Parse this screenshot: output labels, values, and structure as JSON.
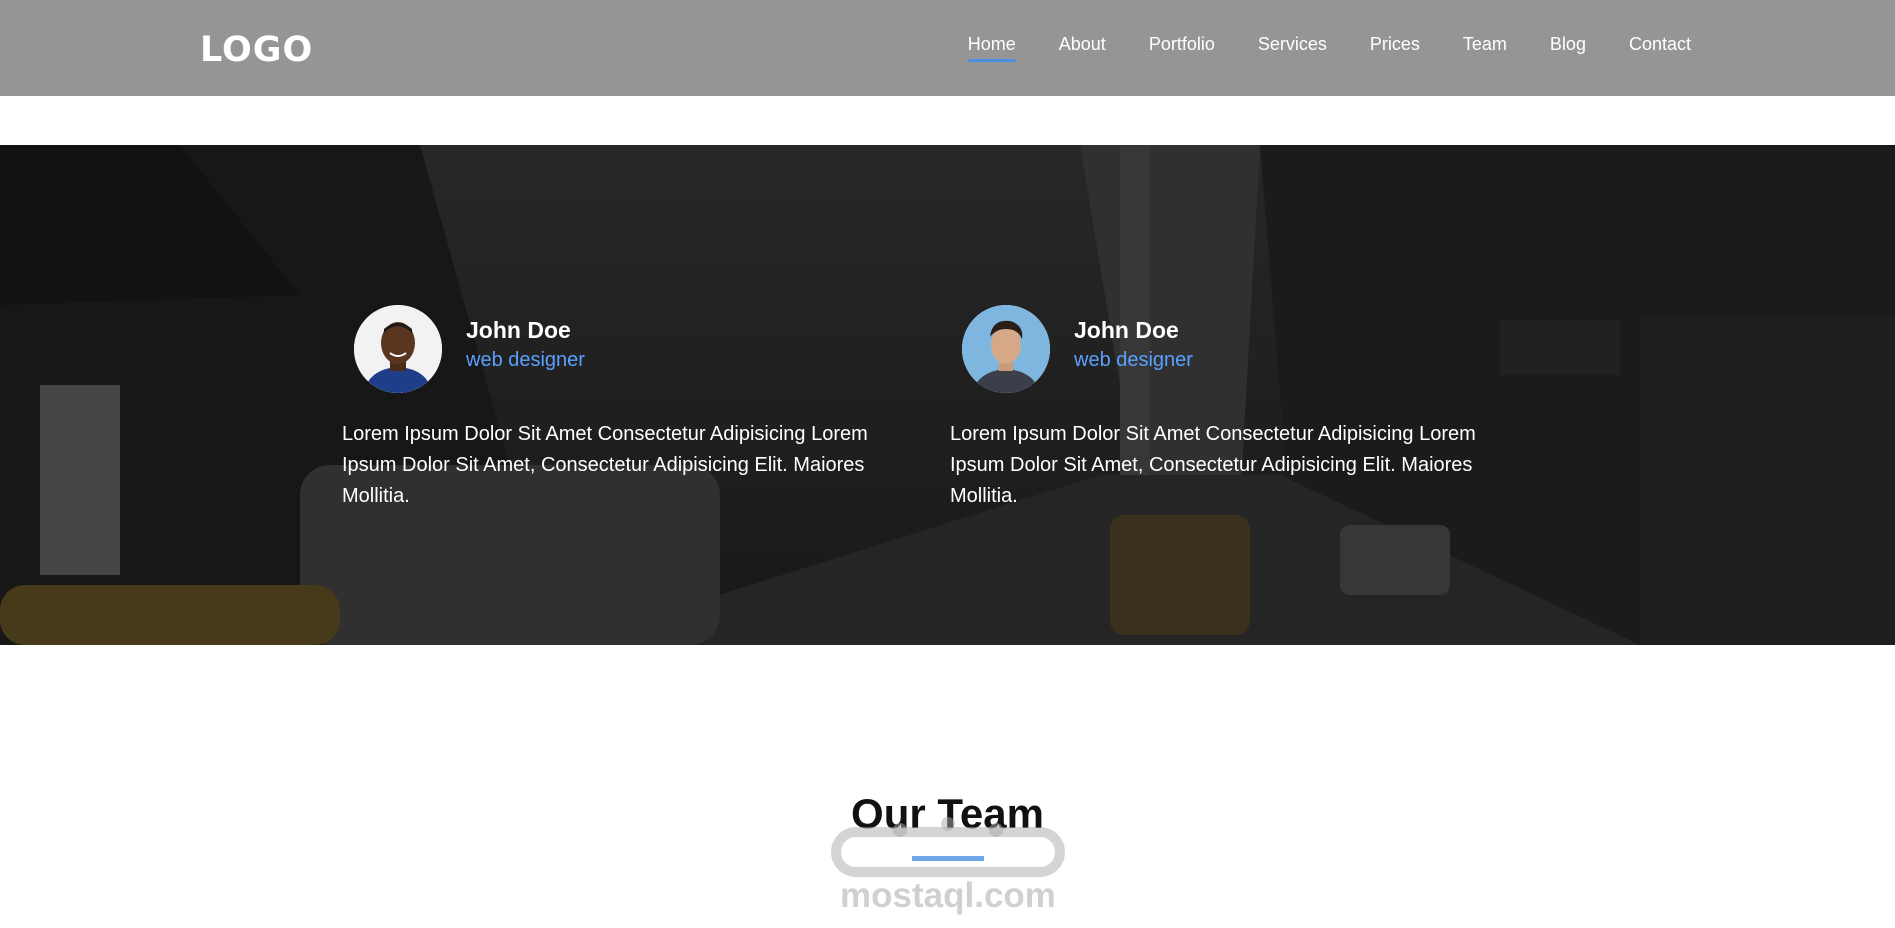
{
  "header": {
    "logo": "LOGO",
    "nav": [
      {
        "label": "Home",
        "active": true
      },
      {
        "label": "About",
        "active": false
      },
      {
        "label": "Portfolio",
        "active": false
      },
      {
        "label": "Services",
        "active": false
      },
      {
        "label": "Prices",
        "active": false
      },
      {
        "label": "Team",
        "active": false
      },
      {
        "label": "Blog",
        "active": false
      },
      {
        "label": "Contact",
        "active": false
      }
    ]
  },
  "testimonials": [
    {
      "name": "John Doe",
      "role": "web designer",
      "text": "Lorem Ipsum Dolor Sit Amet Consectetur Adipisicing Lorem Ipsum Dolor Sit Amet, Consectetur Adipisicing Elit. Maiores Mollitia."
    },
    {
      "name": "John Doe",
      "role": "web designer",
      "text": "Lorem Ipsum Dolor Sit Amet Consectetur Adipisicing Lorem Ipsum Dolor Sit Amet, Consectetur Adipisicing Elit. Maiores Mollitia."
    }
  ],
  "team_section": {
    "title": "Our Team"
  },
  "watermark": {
    "text": "mostaql.com"
  },
  "colors": {
    "header_bg": "#959595",
    "accent": "#4a90e2",
    "role_text": "#5aa0ff"
  }
}
